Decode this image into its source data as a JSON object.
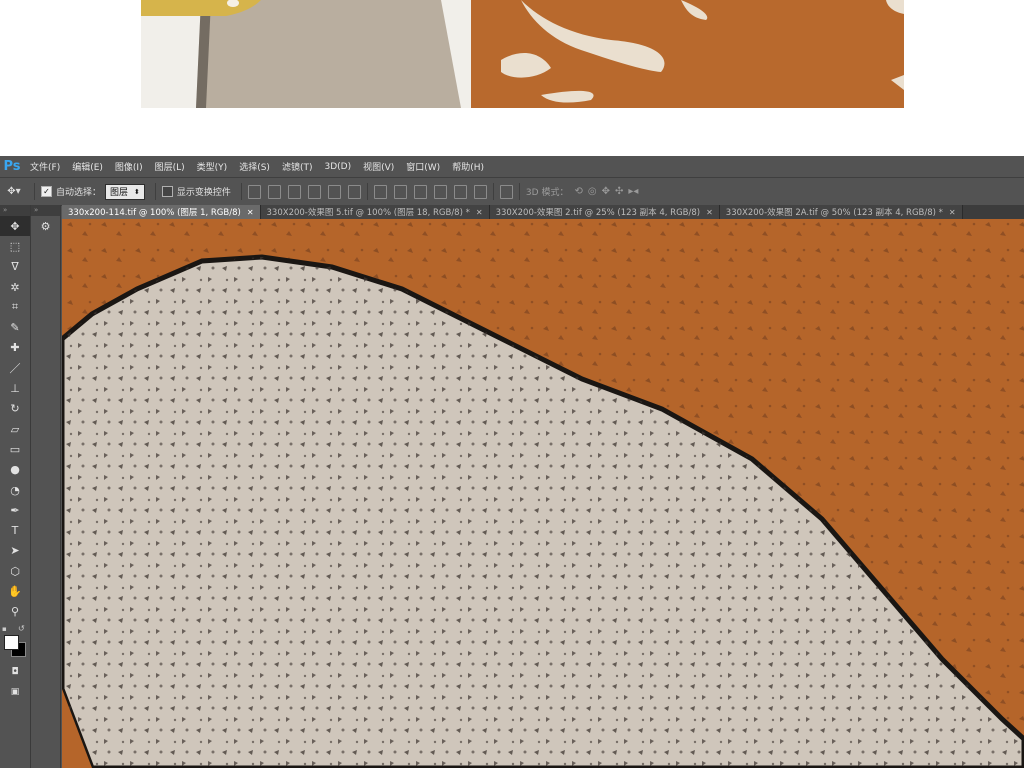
{
  "app": {
    "logo": "Ps",
    "menus": [
      "文件(F)",
      "编辑(E)",
      "图像(I)",
      "图层(L)",
      "类型(Y)",
      "选择(S)",
      "滤镜(T)",
      "3D(D)",
      "视图(V)",
      "窗口(W)",
      "帮助(H)"
    ]
  },
  "options": {
    "auto_select_label": "自动选择：",
    "auto_select_checked": true,
    "auto_select_value": "图层",
    "show_transform_label": "显示变换控件",
    "show_transform_checked": false,
    "mode_3d_label": "3D 模式："
  },
  "tabs": [
    {
      "label": "330x200-114.tif @ 100% (图层 1, RGB/8)",
      "active": true
    },
    {
      "label": "330X200-效果图 5.tif @ 100% (图层 18, RGB/8) *",
      "active": false
    },
    {
      "label": "330X200-效果图 2.tif @ 25% (123 副本 4, RGB/8)",
      "active": false
    },
    {
      "label": "330X200-效果图 2A.tif @ 50% (123 副本 4, RGB/8) *",
      "active": false
    }
  ],
  "tools": [
    {
      "name": "move-tool",
      "glyph": "✥"
    },
    {
      "name": "marquee-tool",
      "glyph": "⬚"
    },
    {
      "name": "lasso-tool",
      "glyph": "ᐁ"
    },
    {
      "name": "magic-wand-tool",
      "glyph": "✲"
    },
    {
      "name": "crop-tool",
      "glyph": "⌗"
    },
    {
      "name": "eyedropper-tool",
      "glyph": "✎"
    },
    {
      "name": "healing-brush-tool",
      "glyph": "✚"
    },
    {
      "name": "brush-tool",
      "glyph": "／"
    },
    {
      "name": "clone-stamp-tool",
      "glyph": "⊥"
    },
    {
      "name": "history-brush-tool",
      "glyph": "↻"
    },
    {
      "name": "eraser-tool",
      "glyph": "▱"
    },
    {
      "name": "gradient-tool",
      "glyph": "▭"
    },
    {
      "name": "blur-tool",
      "glyph": "●"
    },
    {
      "name": "dodge-tool",
      "glyph": "◔"
    },
    {
      "name": "pen-tool",
      "glyph": "✒"
    },
    {
      "name": "type-tool",
      "glyph": "T"
    },
    {
      "name": "path-selection-tool",
      "glyph": "➤"
    },
    {
      "name": "shape-tool",
      "glyph": "⬡"
    },
    {
      "name": "hand-tool",
      "glyph": "✋"
    },
    {
      "name": "zoom-tool",
      "glyph": "⚲"
    }
  ],
  "colors": {
    "ui_dark": "#535353",
    "canvas_orange": "#b5652a",
    "canvas_cream": "#d8d1c8",
    "logo_blue": "#3aa6f0",
    "foreground": "#ffffff",
    "background": "#000000"
  }
}
